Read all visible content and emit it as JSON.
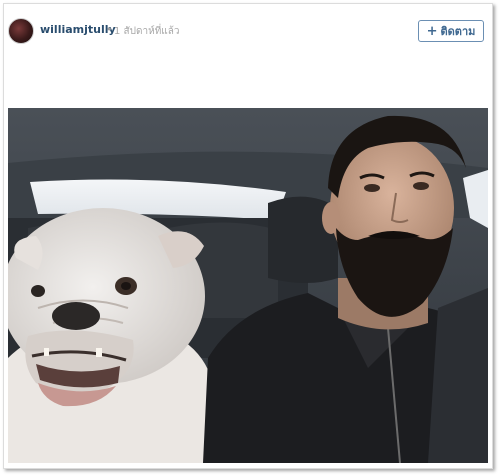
{
  "post": {
    "username": "williamjtully",
    "separator": "•",
    "timestamp": "1 สัปดาห์ที่แล้ว",
    "follow_label": "ติดตาม",
    "follow_icon": "plus-icon"
  },
  "colors": {
    "username": "#2a4d6e",
    "follow_border": "#6b8fb3",
    "follow_text": "#3f6890",
    "timestamp": "#a8a8a8"
  }
}
